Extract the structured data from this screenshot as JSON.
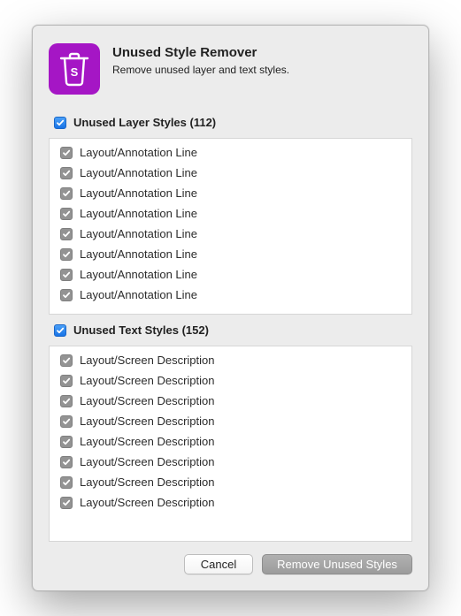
{
  "header": {
    "title": "Unused Style Remover",
    "subtitle": "Remove unused layer and text styles."
  },
  "layerSection": {
    "label": "Unused Layer Styles (112)",
    "items": [
      {
        "label": "Layout/Annotation Line"
      },
      {
        "label": "Layout/Annotation Line"
      },
      {
        "label": "Layout/Annotation Line"
      },
      {
        "label": "Layout/Annotation Line"
      },
      {
        "label": "Layout/Annotation Line"
      },
      {
        "label": "Layout/Annotation Line"
      },
      {
        "label": "Layout/Annotation Line"
      },
      {
        "label": "Layout/Annotation Line"
      }
    ]
  },
  "textSection": {
    "label": "Unused Text Styles (152)",
    "items": [
      {
        "label": "Layout/Screen Description"
      },
      {
        "label": "Layout/Screen Description"
      },
      {
        "label": "Layout/Screen Description"
      },
      {
        "label": "Layout/Screen Description"
      },
      {
        "label": "Layout/Screen Description"
      },
      {
        "label": "Layout/Screen Description"
      },
      {
        "label": "Layout/Screen Description"
      },
      {
        "label": "Layout/Screen Description"
      }
    ]
  },
  "footer": {
    "cancel": "Cancel",
    "confirm": "Remove Unused Styles"
  }
}
